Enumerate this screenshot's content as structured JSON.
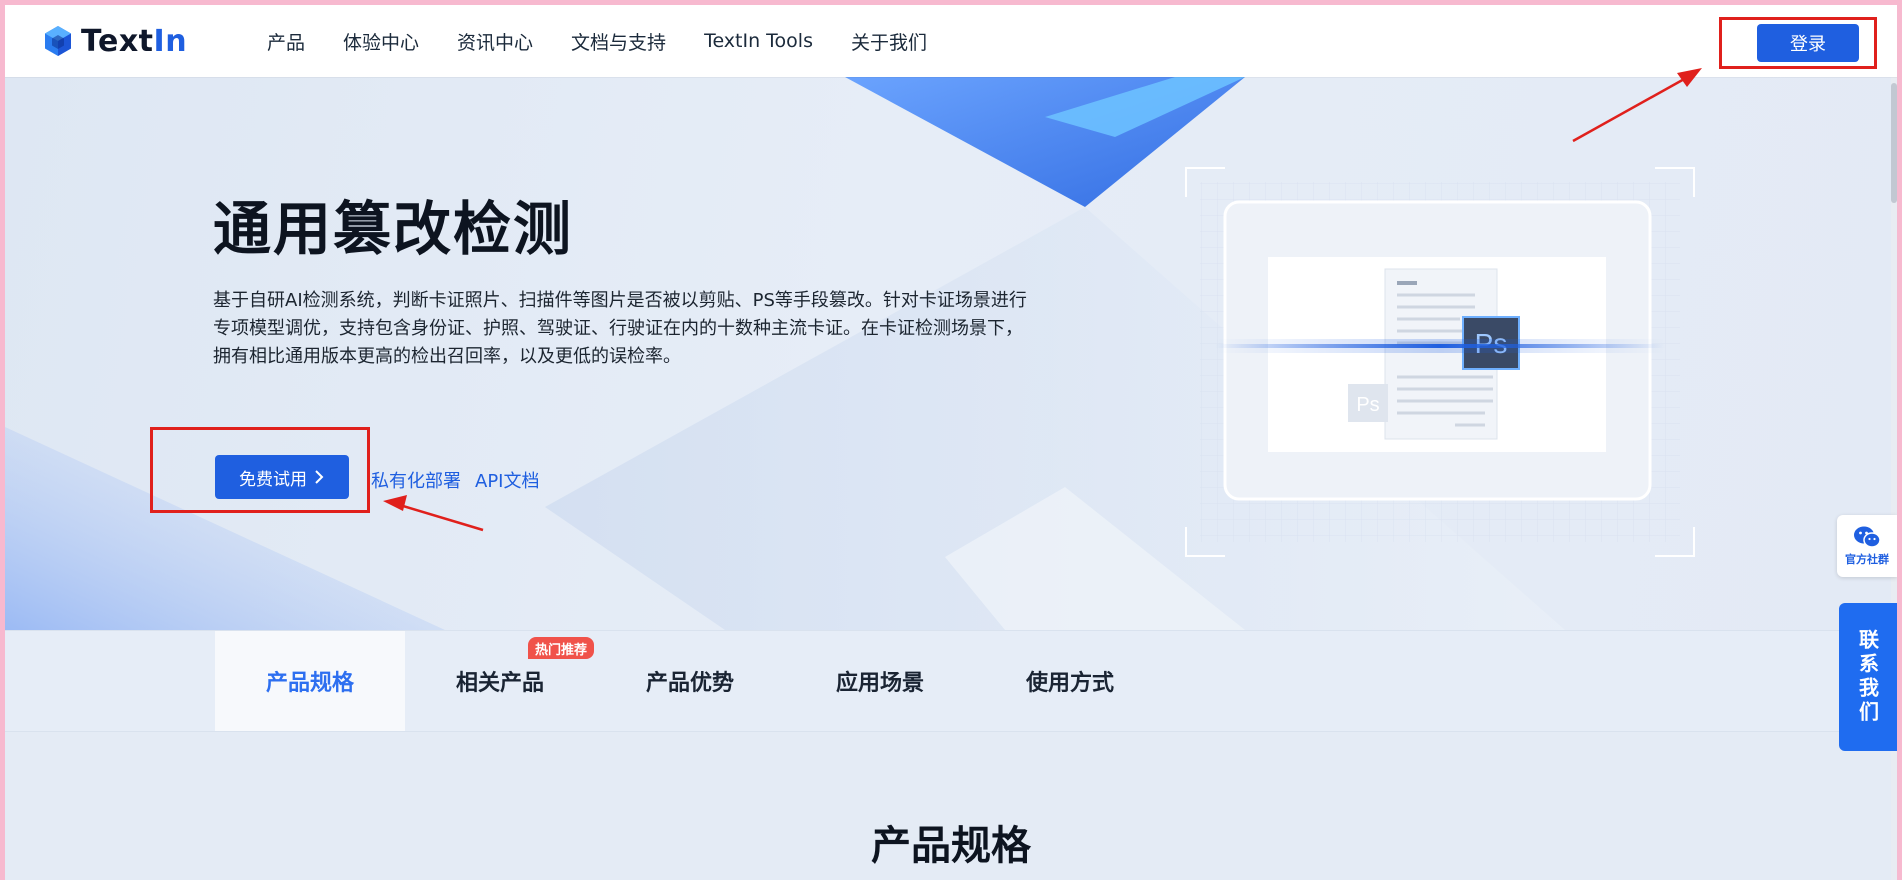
{
  "header": {
    "logo": {
      "text_main": "Text",
      "text_accent": "In"
    },
    "nav": [
      {
        "label": "产品"
      },
      {
        "label": "体验中心"
      },
      {
        "label": "资讯中心"
      },
      {
        "label": "文档与支持"
      },
      {
        "label": "TextIn Tools"
      },
      {
        "label": "关于我们"
      }
    ],
    "login_label": "登录"
  },
  "hero": {
    "title": "通用篡改检测",
    "description": "基于自研AI检测系统，判断卡证照片、扫描件等图片是否被以剪贴、PS等手段篡改。针对卡证场景进行专项模型调优，支持包含身份证、护照、驾驶证、行驶证在内的十数种主流卡证。在卡证检测场景下，拥有相比通用版本更高的检出召回率，以及更低的误检率。",
    "cta_label": "免费试用",
    "link_deploy": "私有化部署",
    "link_api": "API文档",
    "ps_label_large": "Ps",
    "ps_label_small": "Ps"
  },
  "tabs": {
    "items": [
      {
        "label": "产品规格"
      },
      {
        "label": "相关产品"
      },
      {
        "label": "产品优势"
      },
      {
        "label": "应用场景"
      },
      {
        "label": "使用方式"
      }
    ],
    "hot_badge": "热门推荐"
  },
  "section": {
    "title": "产品规格"
  },
  "side": {
    "group_label": "官方社群",
    "contact_label": "联系我们"
  },
  "colors": {
    "brand": "#1f5fe0",
    "annotation": "#e0201c",
    "badge": "#f0524a"
  }
}
